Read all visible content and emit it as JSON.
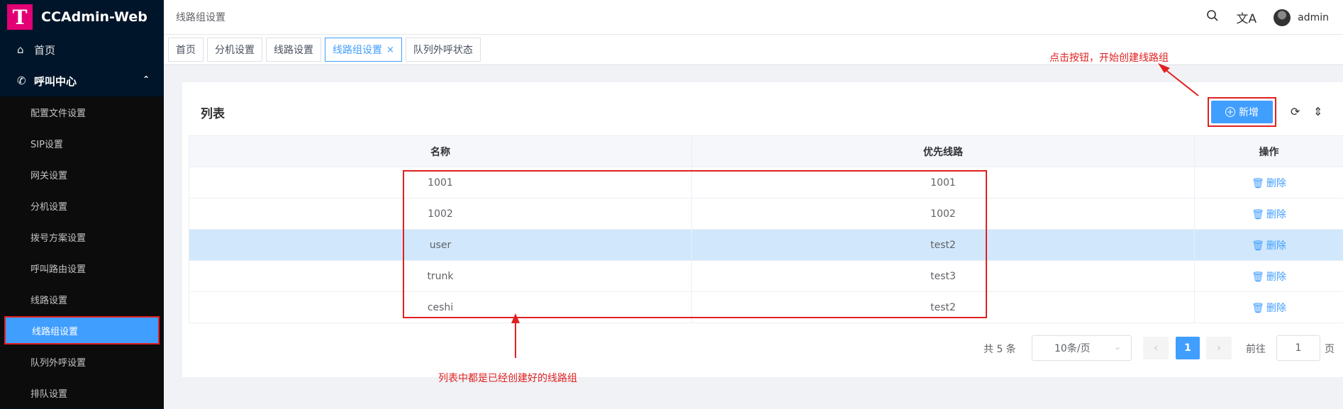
{
  "app": {
    "logo_letter": "T",
    "title": "CCAdmin-Web"
  },
  "sidebar": {
    "home": {
      "label": "首页",
      "icon": "home-icon"
    },
    "group": {
      "label": "呼叫中心",
      "icon": "phone-icon"
    },
    "items": [
      {
        "label": "配置文件设置"
      },
      {
        "label": "SIP设置"
      },
      {
        "label": "网关设置"
      },
      {
        "label": "分机设置"
      },
      {
        "label": "拨号方案设置"
      },
      {
        "label": "呼叫路由设置"
      },
      {
        "label": "线路设置"
      },
      {
        "label": "线路组设置",
        "active": true
      },
      {
        "label": "队列外呼设置"
      },
      {
        "label": "排队设置"
      }
    ]
  },
  "header": {
    "breadcrumb": "线路组设置",
    "user": "admin",
    "icons": [
      "search-icon",
      "translate-icon",
      "avatar"
    ]
  },
  "tabs": [
    {
      "label": "首页"
    },
    {
      "label": "分机设置"
    },
    {
      "label": "线路设置"
    },
    {
      "label": "线路组设置",
      "active": true,
      "close": "×"
    },
    {
      "label": "队列外呼状态"
    }
  ],
  "card": {
    "title": "列表",
    "add_button": "新增",
    "columns": [
      "名称",
      "优先线路",
      "操作"
    ],
    "rows": [
      {
        "name": "1001",
        "line": "1001",
        "action": "删除"
      },
      {
        "name": "1002",
        "line": "1002",
        "action": "删除"
      },
      {
        "name": "user",
        "line": "test2",
        "action": "删除",
        "highlight": true
      },
      {
        "name": "trunk",
        "line": "test3",
        "action": "删除"
      },
      {
        "name": "ceshi",
        "line": "test2",
        "action": "删除"
      }
    ]
  },
  "pagination": {
    "total": "共 5 条",
    "page_size": "10条/页",
    "prev": "‹",
    "current": "1",
    "next": "›",
    "goto_label": "前往",
    "goto_value": "1",
    "page_unit": "页"
  },
  "annotations": {
    "top": "点击按钮，开始创建线路组",
    "bottom": "列表中都是已经创建好的线路组"
  },
  "colors": {
    "accent": "#409eff",
    "sidebar": "#001529",
    "annotation": "#e02020",
    "logo": "#e20074"
  }
}
